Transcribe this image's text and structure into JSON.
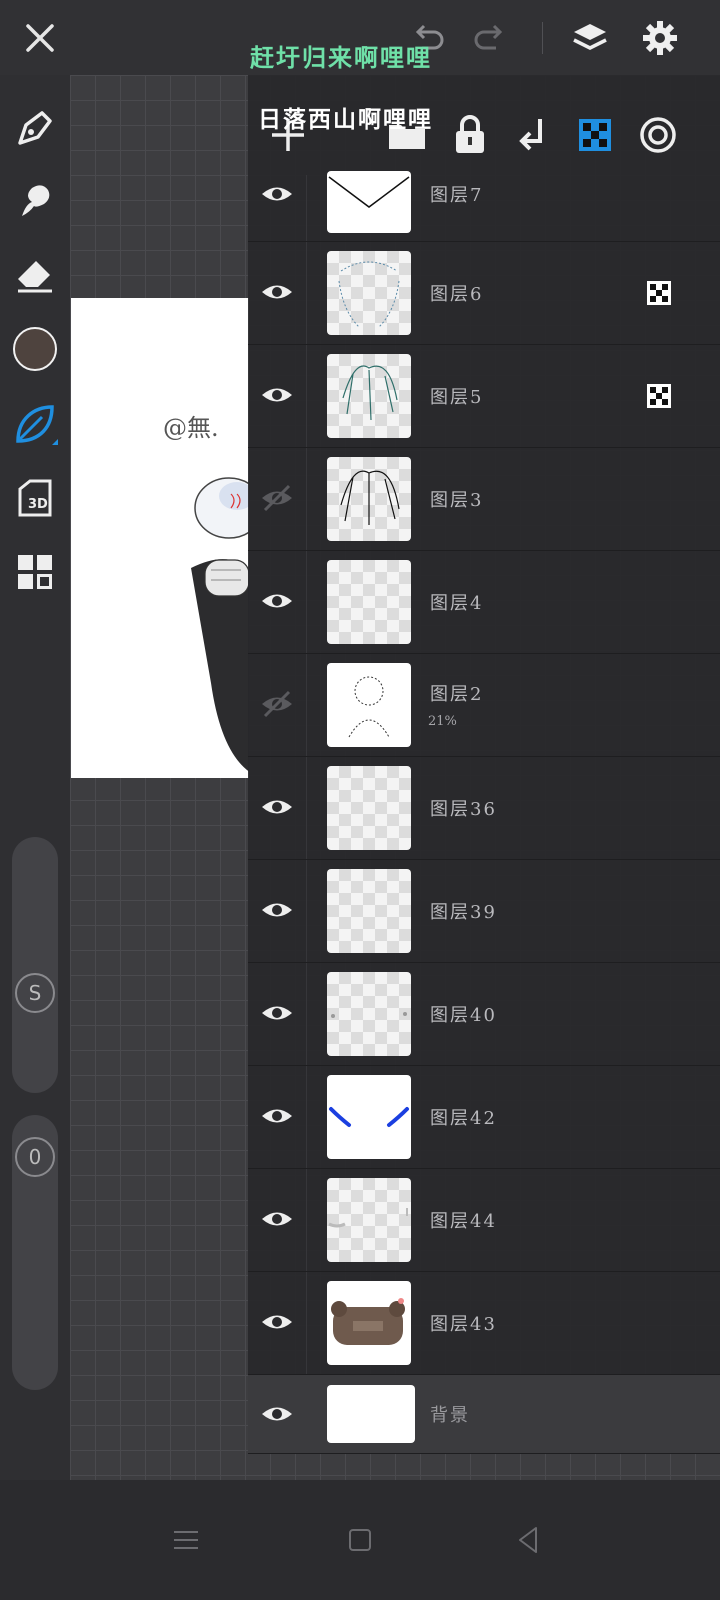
{
  "overlay": {
    "line1": "赶圩归来啊哩哩",
    "line2": "日落西山啊哩哩"
  },
  "artboard": {
    "signature": "@無."
  },
  "colors": {
    "current_brush": "#4e433e",
    "accent": "#1f8fe0",
    "overlay_green": "#6fe0a8"
  },
  "toolbar": {
    "tools": [
      "pen-icon",
      "smudge-icon",
      "eraser-icon",
      "color-swatch",
      "brush-leaf-icon",
      "3d-icon",
      "gallery-icon"
    ],
    "size_slider_label": "S",
    "opacity_slider_label": "0"
  },
  "layers_header": {
    "icons": [
      "add-layer-icon",
      "folder-icon",
      "lock-icon",
      "merge-down-icon",
      "transparency-lock-icon",
      "blend-mode-icon"
    ]
  },
  "layers": [
    {
      "name": "图层7",
      "visible": true,
      "ref": false,
      "thumb": "envelope"
    },
    {
      "name": "图层6",
      "visible": true,
      "ref": true,
      "thumb": "sketch-blue"
    },
    {
      "name": "图层5",
      "visible": true,
      "ref": true,
      "thumb": "hair-teal"
    },
    {
      "name": "图层3",
      "visible": false,
      "ref": false,
      "thumb": "hair-black"
    },
    {
      "name": "图层4",
      "visible": true,
      "ref": false,
      "thumb": "empty"
    },
    {
      "name": "图层2",
      "visible": false,
      "ref": false,
      "thumb": "sketch",
      "opacity": "21%"
    },
    {
      "name": "图层36",
      "visible": true,
      "ref": false,
      "thumb": "empty"
    },
    {
      "name": "图层39",
      "visible": true,
      "ref": false,
      "thumb": "empty"
    },
    {
      "name": "图层40",
      "visible": true,
      "ref": false,
      "thumb": "dots"
    },
    {
      "name": "图层42",
      "visible": true,
      "ref": false,
      "thumb": "brows"
    },
    {
      "name": "图层44",
      "visible": true,
      "ref": false,
      "thumb": "faint"
    },
    {
      "name": "图层43",
      "visible": true,
      "ref": false,
      "thumb": "bear"
    }
  ],
  "background_layer": {
    "name": "背景",
    "visible": true
  }
}
